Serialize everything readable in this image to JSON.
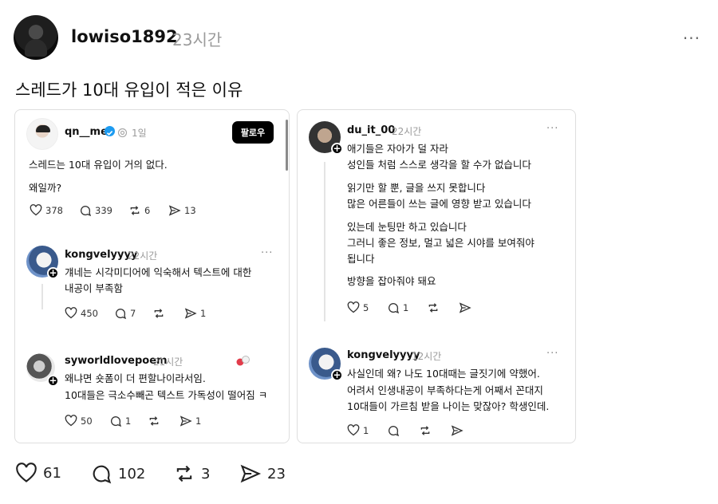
{
  "post": {
    "username": "lowiso1892",
    "time": "23시간",
    "more": "···",
    "caption": "스레드가 10대 유입이 적은 이유",
    "stats": {
      "likes": "61",
      "comments": "102",
      "reposts": "3",
      "shares": "23"
    }
  },
  "left_card": {
    "main": {
      "username": "qn__me",
      "time": "1일",
      "follow": "팔로우",
      "line1": "스레드는 10대 유입이 거의 없다.",
      "line2": "왜일까?",
      "likes": "378",
      "comments": "339",
      "reposts": "6",
      "shares": "13"
    },
    "reply1": {
      "username": "kongvelyyyy",
      "time": "22시간",
      "more": "···",
      "line1": "걔네는 시각미디어에 익숙해서 텍스트에 대한",
      "line2": "내공이 부족함",
      "likes": "450",
      "comments": "7",
      "shares": "1"
    },
    "reply2": {
      "username": "syworldlovepoem",
      "time": "21시간",
      "line1": "왜냐면 숏폼이 더 편할나이라서임.",
      "line2": "10대들은 극소수빼곤 텍스트 가독성이 떨어짐 ㅋ",
      "likes": "50",
      "comments": "1",
      "shares": "1"
    }
  },
  "right_card": {
    "reply1": {
      "username": "du_it_00",
      "time": "22시간",
      "more": "···",
      "l1": "애기들은 자아가 덜 자라",
      "l2": "성인들 처럼 스스로 생각을 할 수가 없습니다",
      "l3": "읽기만 할 뿐, 글을 쓰지 못합니다",
      "l4": "많은 어른들이 쓰는 글에 영향 받고 있습니다",
      "l5": "있는데 눈팅만 하고 있습니다",
      "l6": "그러니 좋은 정보, 멀고 넓은 시야를 보여줘야",
      "l7": "됩니다",
      "l8": "방향을 잡아줘야 돼요",
      "likes": "5",
      "comments": "1"
    },
    "reply2": {
      "username": "kongvelyyyy",
      "time": "12시간",
      "more": "···",
      "l1": "사실인데 왜? 나도 10대때는 글짓기에 약했어.",
      "l2": "어려서 인생내공이 부족하다는게 어째서 꼰대지",
      "l3": "10대들이 가르침 받을 나이는 맞잖아? 학생인데.",
      "likes": "1"
    }
  }
}
